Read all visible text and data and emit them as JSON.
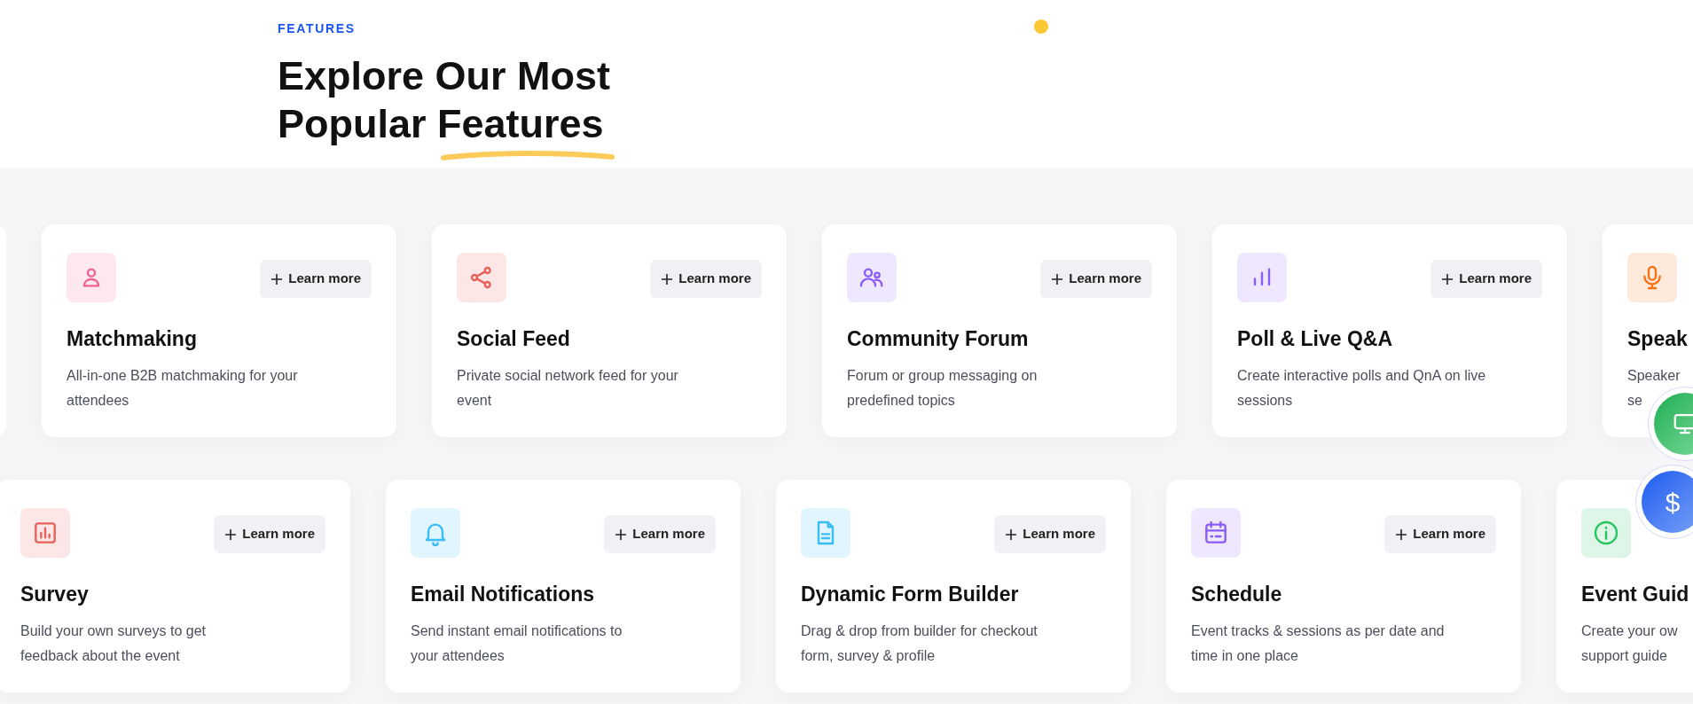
{
  "section_label": "FEATURES",
  "heading": {
    "text": "Explore Our Most Popular",
    "highlight": "Features"
  },
  "rows": [
    {
      "cards": [
        {
          "title": "Matchmaking",
          "desc": [
            "All-in-one B2B matchmaking for your",
            "attendees"
          ],
          "button": "Learn more",
          "color": "#f06292"
        },
        {
          "title": "Social Feed",
          "desc": [
            "Private social network feed for your",
            "event"
          ],
          "button": "Learn more",
          "color": "#e8615a"
        },
        {
          "title": "Community Forum",
          "desc": [
            "Forum or group messaging on",
            "predefined topics"
          ],
          "button": "Learn more",
          "color": "#8b5cf6"
        },
        {
          "title": "Poll & Live Q&A",
          "desc": [
            "Create interactive polls and QnA on live",
            "sessions"
          ],
          "button": "Learn more",
          "color": "#8b5cf6"
        },
        {
          "title": "Speak",
          "desc": [
            "Speaker",
            "se"
          ],
          "color": "#f97316"
        }
      ]
    },
    {
      "cards": [
        {
          "title": "Survey",
          "desc": [
            "Build your own surveys to get",
            "feedback about the event"
          ],
          "button": "Learn more",
          "color": "#e8615a"
        },
        {
          "title": "Email Notifications",
          "desc": [
            "Send instant email notifications to",
            "your attendees"
          ],
          "button": "Learn more",
          "color": "#38bdf8"
        },
        {
          "title": "Dynamic Form Builder",
          "desc": [
            "Drag & drop from builder for checkout",
            "form, survey & profile"
          ],
          "button": "Learn more",
          "color": "#38bdf8"
        },
        {
          "title": "Schedule",
          "desc": [
            "Event tracks & sessions as per date and",
            "time in one place"
          ],
          "button": "Learn more",
          "color": "#8b5cf6"
        },
        {
          "title": "Event Guid",
          "desc": [
            "Create your ow",
            "support guide"
          ],
          "color": "#22c55e"
        }
      ]
    }
  ],
  "floating_buttons": [
    {
      "kind": "monitor"
    },
    {
      "kind": "text",
      "label": "$"
    }
  ]
}
